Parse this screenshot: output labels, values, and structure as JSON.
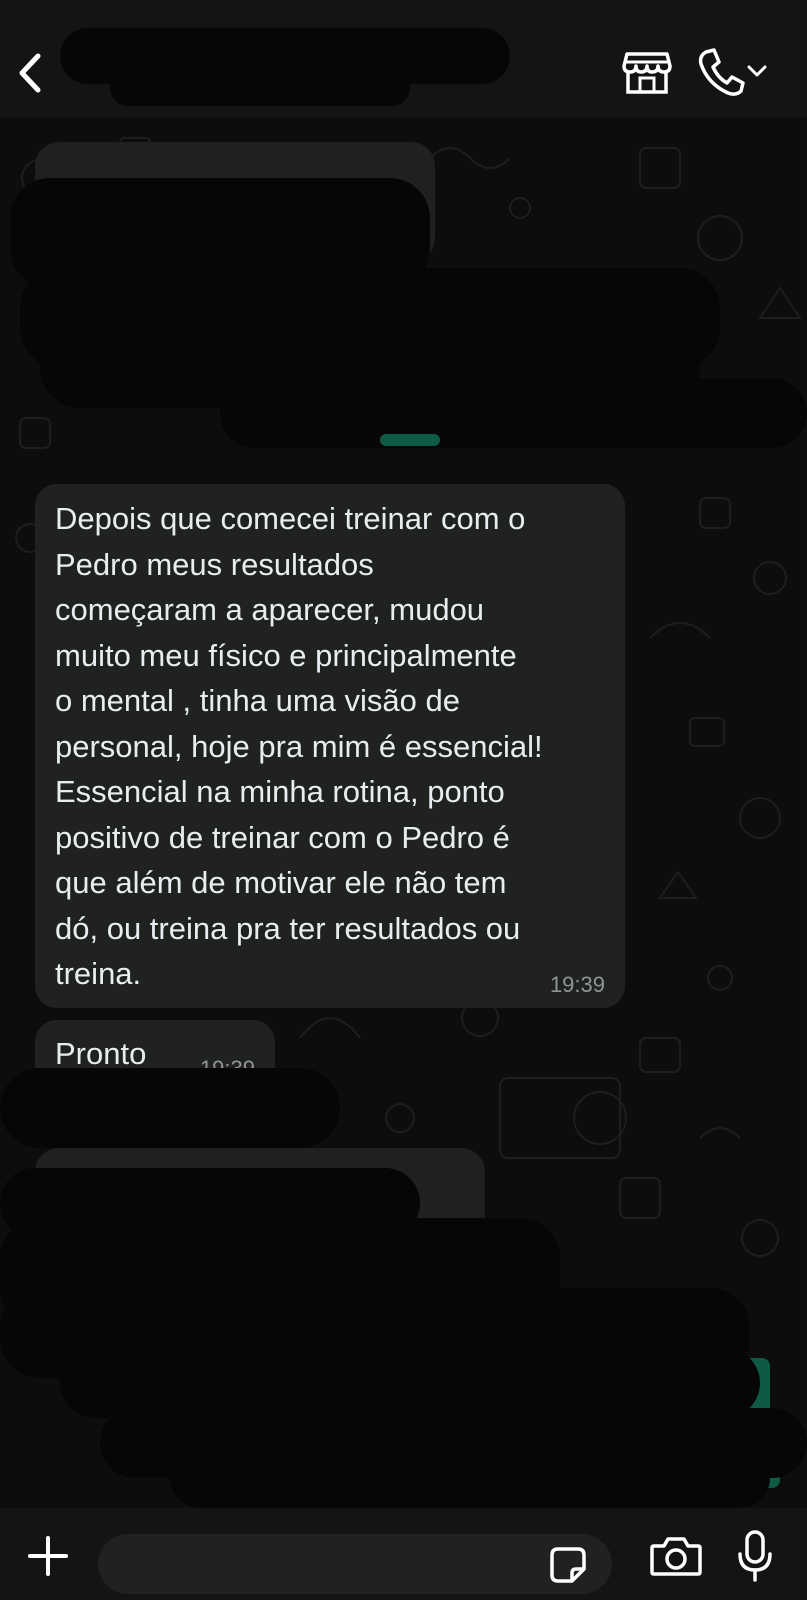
{
  "header": {
    "back_icon": "chevron-left-icon",
    "store_icon": "storefront-icon",
    "call_icon": "phone-icon",
    "call_menu_icon": "chevron-down-icon"
  },
  "messages": [
    {
      "text": "Depois que comecei treinar com o\nPedro meus resultados\ncomeçaram a aparecer, mudou\nmuito meu físico e principalmente\no mental , tinha uma visão de\npersonal, hoje pra mim é essencial!\nEssencial na minha rotina, ponto\npositivo de treinar com o Pedro é\nque além de motivar ele não tem\ndó, ou treina pra ter resultados ou\ntreina.",
      "time": "19:39"
    },
    {
      "text": "Pronto",
      "time": "19:39"
    }
  ],
  "composer": {
    "placeholder": "",
    "plus_icon": "plus-icon",
    "sticker_icon": "sticker-icon",
    "camera_icon": "camera-icon",
    "mic_icon": "microphone-icon"
  },
  "colors": {
    "background": "#0b0c0b",
    "bar": "#121513",
    "bubble_incoming": "#202220",
    "bubble_outgoing_peek": "#0f5a46",
    "time_text": "#8f9794"
  }
}
